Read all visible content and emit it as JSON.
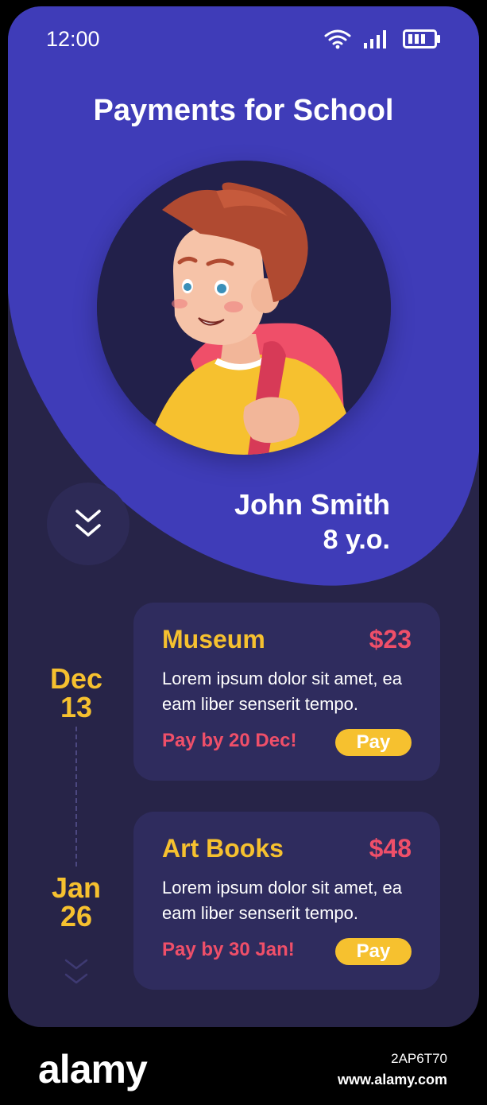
{
  "status_bar": {
    "time": "12:00"
  },
  "header": {
    "title": "Payments for School"
  },
  "profile": {
    "name": "John Smith",
    "age": "8 y.o."
  },
  "payments": [
    {
      "date_month": "Dec",
      "date_day": "13",
      "title": "Museum",
      "price": "$23",
      "description": "Lorem ipsum dolor sit amet, ea eam liber senserit tempo.",
      "due": "Pay by 20 Dec!",
      "pay_label": "Pay"
    },
    {
      "date_month": "Jan",
      "date_day": "26",
      "title": "Art Books",
      "price": "$48",
      "description": "Lorem ipsum dolor sit amet, ea eam liber senserit tempo.",
      "due": "Pay by 30 Jan!",
      "pay_label": "Pay"
    }
  ],
  "footer": {
    "brand": "alamy",
    "image_id": "2AP6T70",
    "site": "www.alamy.com"
  },
  "colors": {
    "background": "#272448",
    "header_blob": "#3f3cb8",
    "card": "#2f2c5e",
    "accent_yellow": "#f6c12f",
    "accent_red": "#ef4f69"
  },
  "icons": [
    "wifi-icon",
    "signal-icon",
    "battery-icon",
    "double-chevron-down-icon"
  ]
}
